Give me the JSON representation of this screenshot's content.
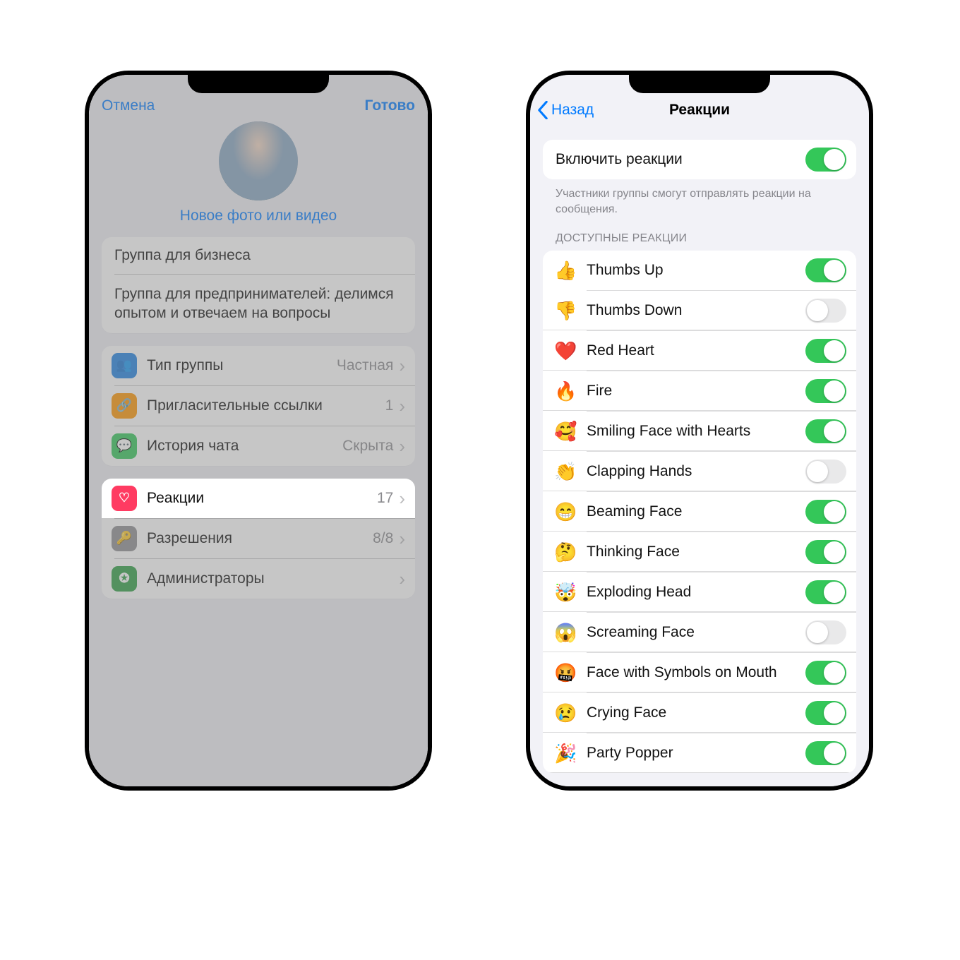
{
  "left": {
    "nav_cancel": "Отмена",
    "nav_done": "Готово",
    "photo_action": "Новое фото или видео",
    "group_name": "Группа для бизнеса",
    "group_desc": "Группа для предпринимателей: делимся опытом и отвечаем на вопросы",
    "rows1": {
      "type_label": "Тип группы",
      "type_value": "Частная",
      "invite_label": "Пригласительные ссылки",
      "invite_value": "1",
      "history_label": "История чата",
      "history_value": "Скрыта"
    },
    "rows2": {
      "reactions_label": "Реакции",
      "reactions_value": "17",
      "perm_label": "Разрешения",
      "perm_value": "8/8",
      "admins_label": "Администраторы",
      "admins_value": ""
    }
  },
  "right": {
    "back": "Назад",
    "title": "Реакции",
    "enable_label": "Включить реакции",
    "enable_footer": "Участники группы смогут отправлять реакции на сообщения.",
    "section_header": "ДОСТУПНЫЕ РЕАКЦИИ",
    "items": [
      {
        "emoji": "👍",
        "label": "Thumbs Up",
        "on": true
      },
      {
        "emoji": "👎",
        "label": "Thumbs Down",
        "on": false
      },
      {
        "emoji": "❤️",
        "label": "Red Heart",
        "on": true
      },
      {
        "emoji": "🔥",
        "label": "Fire",
        "on": true
      },
      {
        "emoji": "🥰",
        "label": "Smiling Face with Hearts",
        "on": true
      },
      {
        "emoji": "👏",
        "label": "Clapping Hands",
        "on": false
      },
      {
        "emoji": "😁",
        "label": "Beaming Face",
        "on": true
      },
      {
        "emoji": "🤔",
        "label": "Thinking Face",
        "on": true
      },
      {
        "emoji": "🤯",
        "label": "Exploding Head",
        "on": true
      },
      {
        "emoji": "😱",
        "label": "Screaming Face",
        "on": false
      },
      {
        "emoji": "🤬",
        "label": "Face with Symbols on Mouth",
        "on": true
      },
      {
        "emoji": "😢",
        "label": "Crying Face",
        "on": true
      },
      {
        "emoji": "🎉",
        "label": "Party Popper",
        "on": true
      }
    ]
  }
}
